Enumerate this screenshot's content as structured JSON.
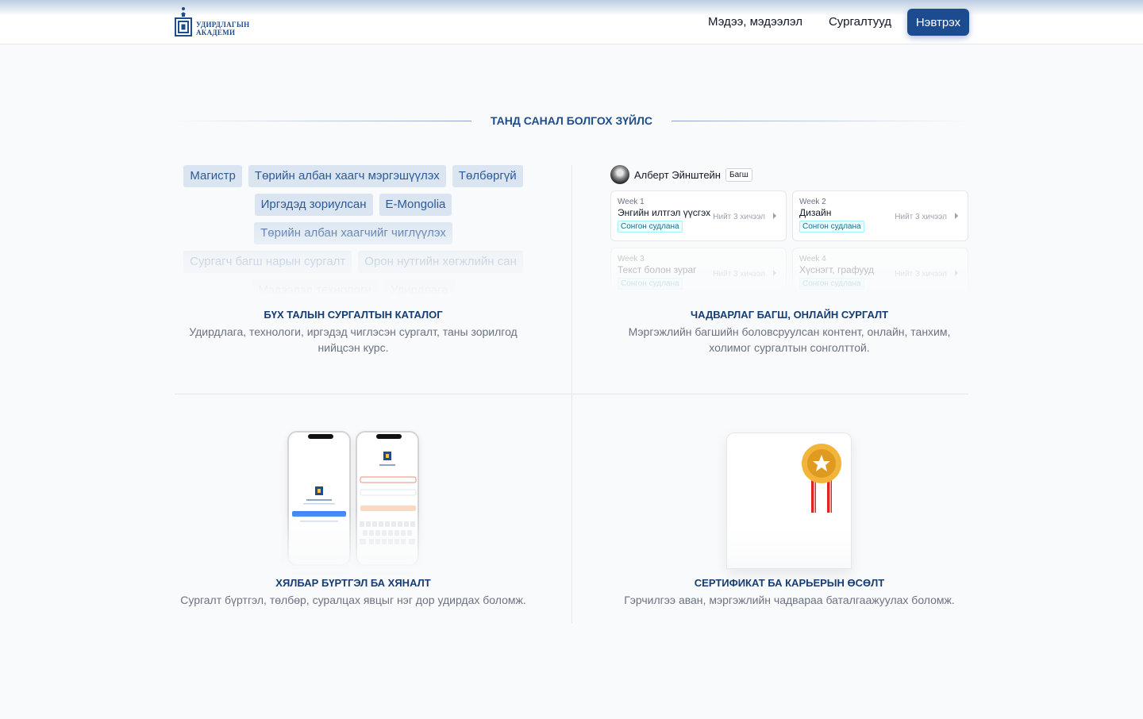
{
  "header": {
    "logo_line1": "УДИРДЛАГЫН",
    "logo_line2": "АКАДЕМИ",
    "nav": [
      "Мэдээ, мэдээлэл",
      "Сургалтууд"
    ],
    "login_label": "Нэвтрэх"
  },
  "section": {
    "title": "ТАНД САНАЛ БОЛГОХ ЗҮЙЛС"
  },
  "catalog": {
    "tag_rows": [
      [
        "Магистр",
        "Төрийн албан хаагч мэргэшүүлэх",
        "Төлбөргүй"
      ],
      [
        "Иргэдэд зориулсан",
        "E-Mongolia"
      ],
      [
        "Төрийн албан хаагчийг чиглүүлэх"
      ],
      [
        "Сургагч багш нарын сургалт",
        "Орон нутгийн хөгжлийн сан"
      ],
      [
        "Мэдээлэл технологи",
        "Удирдлага"
      ]
    ],
    "title": "БҮХ ТАЛЫН СУРГАЛТЫН КАТАЛОГ",
    "desc": "Удирдлага, технологи, иргэдэд чиглэсэн сургалт, таны зорилгод нийцсэн курс."
  },
  "teachers": {
    "name": "Алберт Эйнштейн",
    "role": "Багш",
    "weeks": [
      {
        "num": "Week 1",
        "title": "Энгийн илтгэл үүсгэх",
        "meta": "Нийт 3 хичээл",
        "badge": "Сонгон судлана"
      },
      {
        "num": "Week 2",
        "title": "Дизайн",
        "meta": "Нийт 3 хичээл",
        "badge": "Сонгон судлана"
      },
      {
        "num": "Week 3",
        "title": "Текст болон зураг",
        "meta": "Нийт 3 хичээл",
        "badge": "Сонгон судлана"
      },
      {
        "num": "Week 4",
        "title": "Хүснэгт, графууд",
        "meta": "Нийт 3 хичээл",
        "badge": "Сонгон судлана"
      }
    ],
    "title": "ЧАДВАРЛАГ БАГШ, ОНЛАЙН СУРГАЛТ",
    "desc": "Мэргэжлийн багшийн боловсруулсан контент, онлайн, танхим, холимог сургалтын сонголттой."
  },
  "registration": {
    "title": "ХЯЛБАР БҮРТГЭЛ БА ХЯНАЛТ",
    "desc": "Сургалт бүртгэл, төлбөр, суралцах явцыг нэг дор удирдах боломж."
  },
  "certificate": {
    "title": "СЕРТИФИКАТ БА КАРЬЕРЫН ӨСӨЛТ",
    "desc": "Гэрчилгээ аван, мэргэжлийн чадвараа баталгаажуулах боломж."
  },
  "colors": {
    "brand": "#1d4b8f",
    "title": "#163d73",
    "tag_bg": "#dbe5f1",
    "badge": "#0e7490"
  }
}
